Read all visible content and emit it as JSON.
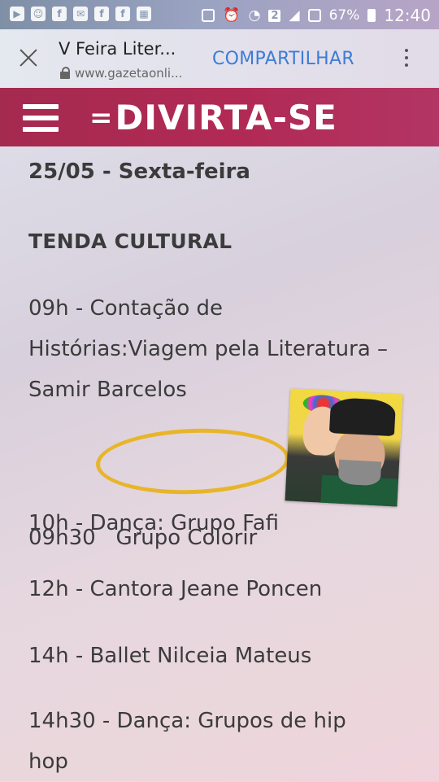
{
  "status_bar": {
    "battery": "67%",
    "time": "12:40",
    "sim_slot": "2"
  },
  "browser": {
    "title": "V Feira Liter...",
    "url": "www.gazetaonli...",
    "share_label": "COMPARTILHAR"
  },
  "header": {
    "logo": "DIVIRTA-SE",
    "logo_mark": "=",
    "brand_color": "#b02a55"
  },
  "content": {
    "date": "25/05 - Sexta-feira",
    "section": "TENDA CULTURAL",
    "items": [
      {
        "line1": "09h - Contação de",
        "line2": "Histórias:Viagem pela Literatura –",
        "line3": "Samir Barcelos"
      },
      {
        "line1": "09h30   Grupo Colorir"
      },
      {
        "line1": "10h - Dança: Grupo Fafi"
      },
      {
        "line1": "12h - Cantora Jeane Poncen"
      },
      {
        "line1": "14h - Ballet Nilceia Mateus"
      },
      {
        "line1": "14h30 - Dança: Grupos de hip",
        "line2": "hop"
      }
    ],
    "highlight_color": "#e8b52a"
  }
}
